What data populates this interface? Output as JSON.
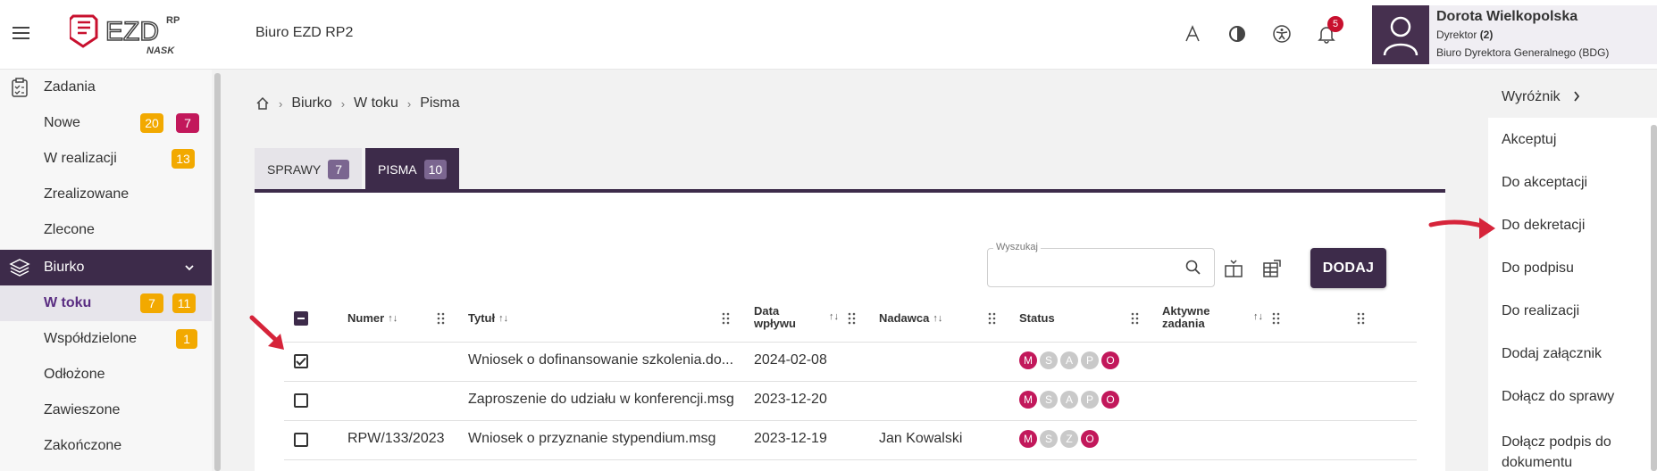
{
  "header": {
    "office": "Biuro EZD RP2",
    "logo_text": "EZD",
    "logo_sup": "RP",
    "logo_sub": "NASK",
    "bell_count": "5",
    "user": {
      "name": "Dorota Wielkopolska",
      "role": "Dyrektor",
      "role_count": "(2)",
      "department": "Biuro Dyrektora Generalnego (BDG)"
    }
  },
  "sidebar": {
    "tasks": "Zadania",
    "items": [
      {
        "label": "Nowe",
        "c1": "20",
        "c2": "7"
      },
      {
        "label": "W realizacji",
        "c1": "13"
      },
      {
        "label": "Zrealizowane"
      },
      {
        "label": "Zlecone"
      }
    ],
    "desk": "Biurko",
    "desk_items": [
      {
        "label": "W toku",
        "c1": "7",
        "c2": "11"
      },
      {
        "label": "Współdzielone",
        "c1": "1"
      },
      {
        "label": "Odłożone"
      },
      {
        "label": "Zawieszone"
      },
      {
        "label": "Zakończone"
      }
    ]
  },
  "breadcrumb": [
    "Biurko",
    "W toku",
    "Pisma"
  ],
  "tabs": [
    {
      "label": "SPRAWY",
      "count": "7"
    },
    {
      "label": "PISMA",
      "count": "10"
    }
  ],
  "search": {
    "label": "Wyszukaj"
  },
  "add_button": "DODAJ",
  "table": {
    "headers": {
      "numer": "Numer",
      "tytul": "Tytuł",
      "data_l1": "Data",
      "data_l2": "wpływu",
      "nadawca": "Nadawca",
      "status": "Status",
      "aktywne_l1": "Aktywne",
      "aktywne_l2": "zadania"
    },
    "rows": [
      {
        "numer": "",
        "tytul": "Wniosek o dofinansowanie szkolenia.do...",
        "data": "2024-02-08",
        "nadawca": "",
        "status": [
          "M",
          "S",
          "A",
          "P",
          "O"
        ],
        "checked": true
      },
      {
        "numer": "",
        "tytul": "Zaproszenie do udziału w konferencji.msg",
        "data": "2023-12-20",
        "nadawca": "",
        "status": [
          "M",
          "S",
          "A",
          "P",
          "O"
        ],
        "checked": false
      },
      {
        "numer": "RPW/133/2023",
        "tytul": "Wniosek o przyznanie stypendium.msg",
        "data": "2023-12-19",
        "nadawca": "Jan Kowalski",
        "status": [
          "M",
          "S",
          "Z",
          "O"
        ],
        "checked": false
      }
    ]
  },
  "right_menu": [
    "Wyróżnik",
    "Akceptuj",
    "Do akceptacji",
    "Do dekretacji",
    "Do podpisu",
    "Do realizacji",
    "Dodaj załącznik",
    "Dołącz do sprawy",
    "Dołącz podpis do",
    "dokumentu"
  ],
  "colors": {
    "primary": "#3d2b4a",
    "badge_yellow": "#f2a900",
    "badge_pink": "#c2185b",
    "arrow_red": "#d6243a"
  }
}
